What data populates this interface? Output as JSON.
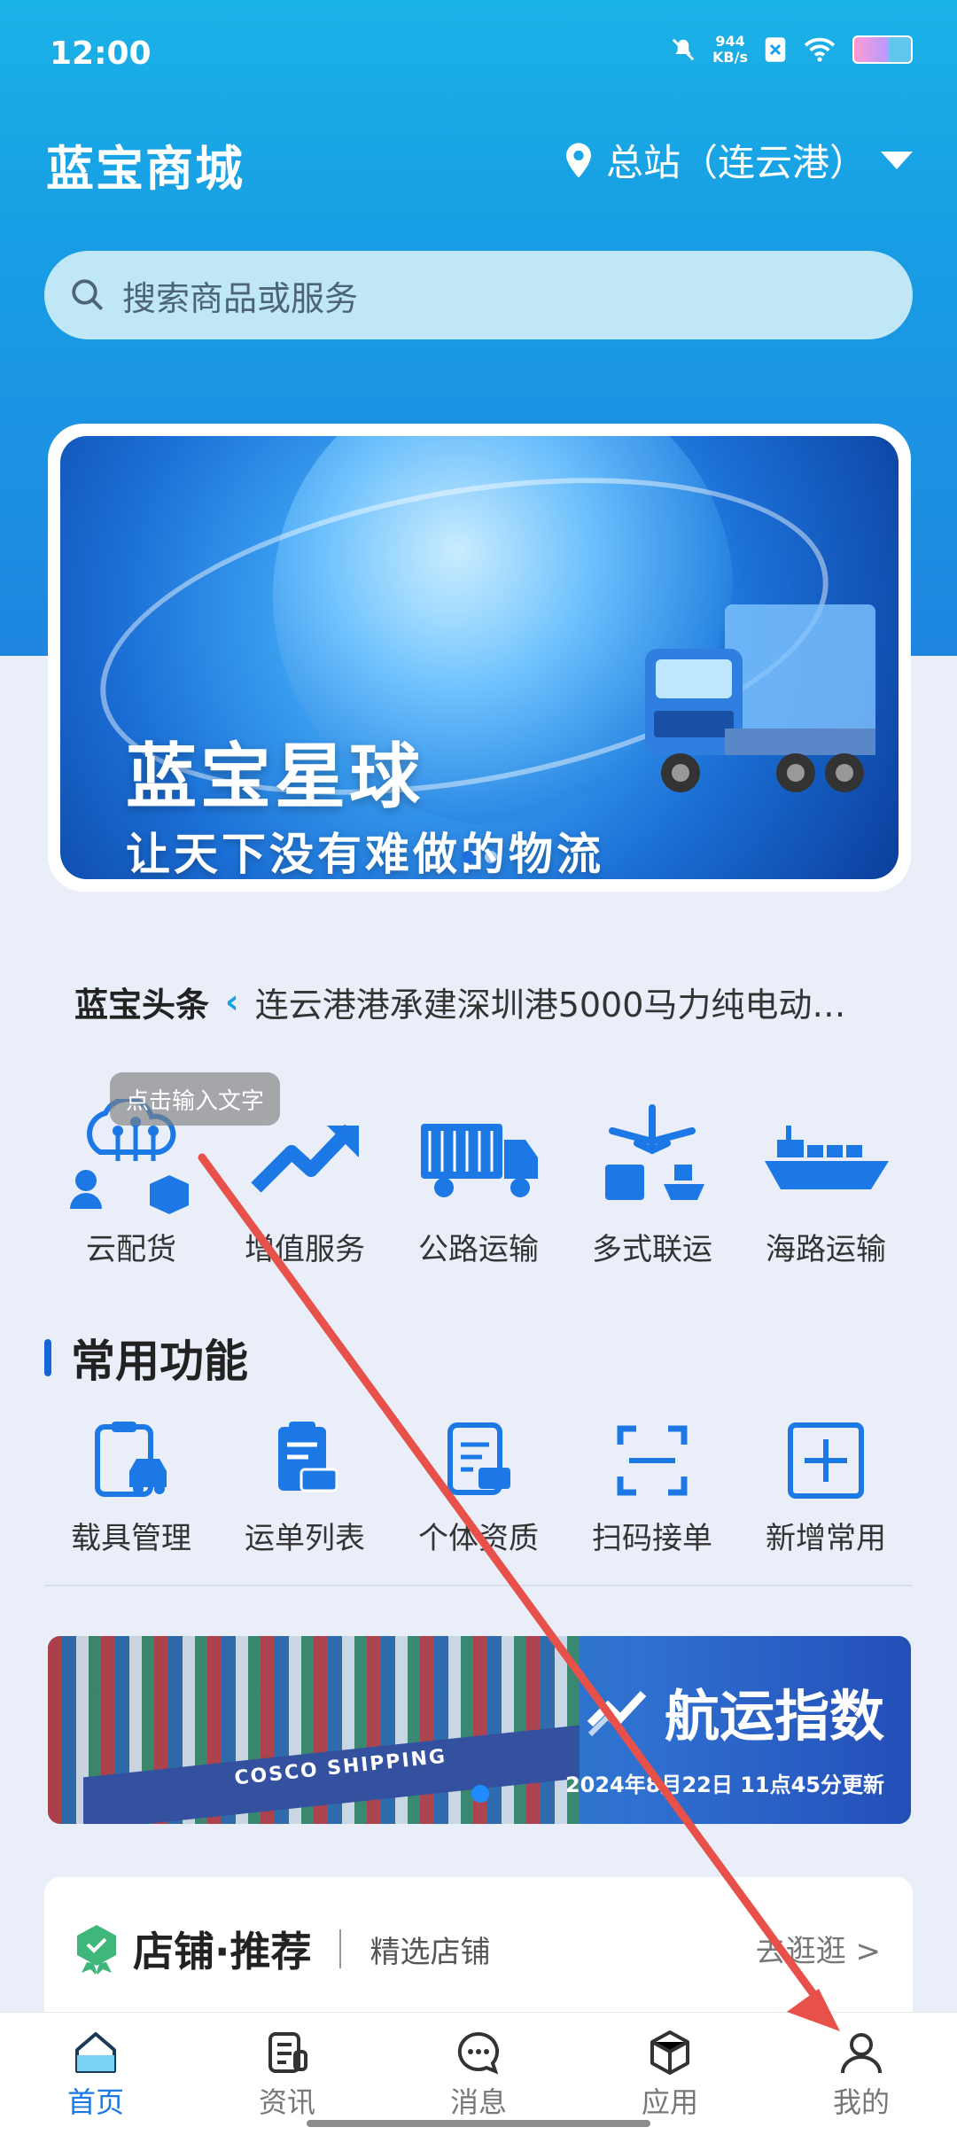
{
  "status_bar": {
    "time": "12:00",
    "net_speed_value": "944",
    "net_speed_unit": "KB/s"
  },
  "header": {
    "app_title": "蓝宝商城",
    "location": "总站（连云港）"
  },
  "search": {
    "placeholder": "搜索商品或服务"
  },
  "banner": {
    "title": "蓝宝星球",
    "subtitle": "让天下没有难做的物流"
  },
  "news": {
    "label": "蓝宝头条",
    "text": "连云港港承建深圳港5000马力纯电动…"
  },
  "tooltip": {
    "text": "点击输入文字"
  },
  "services": [
    {
      "label": "云配货",
      "icon": "cloud-dispatch-icon"
    },
    {
      "label": "增值服务",
      "icon": "trend-up-icon"
    },
    {
      "label": "公路运输",
      "icon": "truck-icon"
    },
    {
      "label": "多式联运",
      "icon": "multimodal-icon"
    },
    {
      "label": "海路运输",
      "icon": "ship-icon"
    }
  ],
  "common": {
    "title": "常用功能",
    "items": [
      {
        "label": "载具管理",
        "icon": "vehicle-clipboard-icon"
      },
      {
        "label": "运单列表",
        "icon": "waybill-icon"
      },
      {
        "label": "个体资质",
        "icon": "qualification-icon"
      },
      {
        "label": "扫码接单",
        "icon": "scan-icon"
      },
      {
        "label": "新增常用",
        "icon": "add-icon"
      }
    ]
  },
  "shipping_banner": {
    "hull_text": "COSCO SHIPPING",
    "title": "航运指数",
    "date": "2024年8月22日 11点45分更新"
  },
  "store": {
    "title": "店铺·推荐",
    "subtitle": "精选店铺",
    "more": "去逛逛 >"
  },
  "tabbar": [
    {
      "label": "首页",
      "active": true
    },
    {
      "label": "资讯",
      "active": false
    },
    {
      "label": "消息",
      "active": false
    },
    {
      "label": "应用",
      "active": false
    },
    {
      "label": "我的",
      "active": false
    }
  ],
  "colors": {
    "brand_blue": "#1b78e4",
    "header_gradient_top": "#1bb2e7",
    "annotation_arrow": "#e8504a"
  }
}
